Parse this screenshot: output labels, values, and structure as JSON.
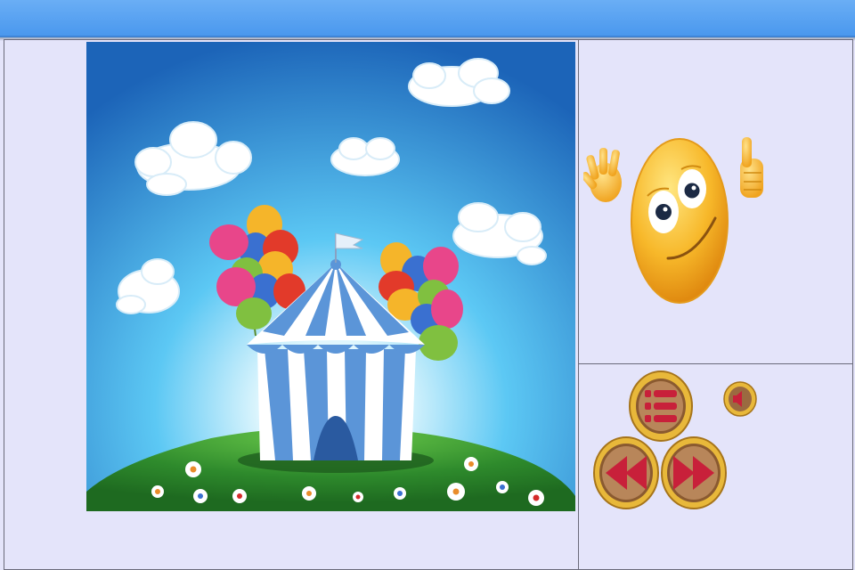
{
  "window": {
    "title": ""
  },
  "scene": {
    "subject": "circus-tent-picture"
  },
  "controls": {
    "menu": {
      "icon": "list-icon"
    },
    "sound": {
      "icon": "speaker-icon"
    },
    "previous": {
      "icon": "rewind-icon"
    },
    "next": {
      "icon": "fast-forward-icon"
    }
  },
  "colors": {
    "topbar": "#5aa3f2",
    "panel_bg": "#e4e4fa",
    "sky_top": "#1c64b8",
    "sky_bottom": "#5cc8f4",
    "grass": "#2e8a2c",
    "button_gold": "#d7a21e",
    "button_red": "#c8203a"
  }
}
